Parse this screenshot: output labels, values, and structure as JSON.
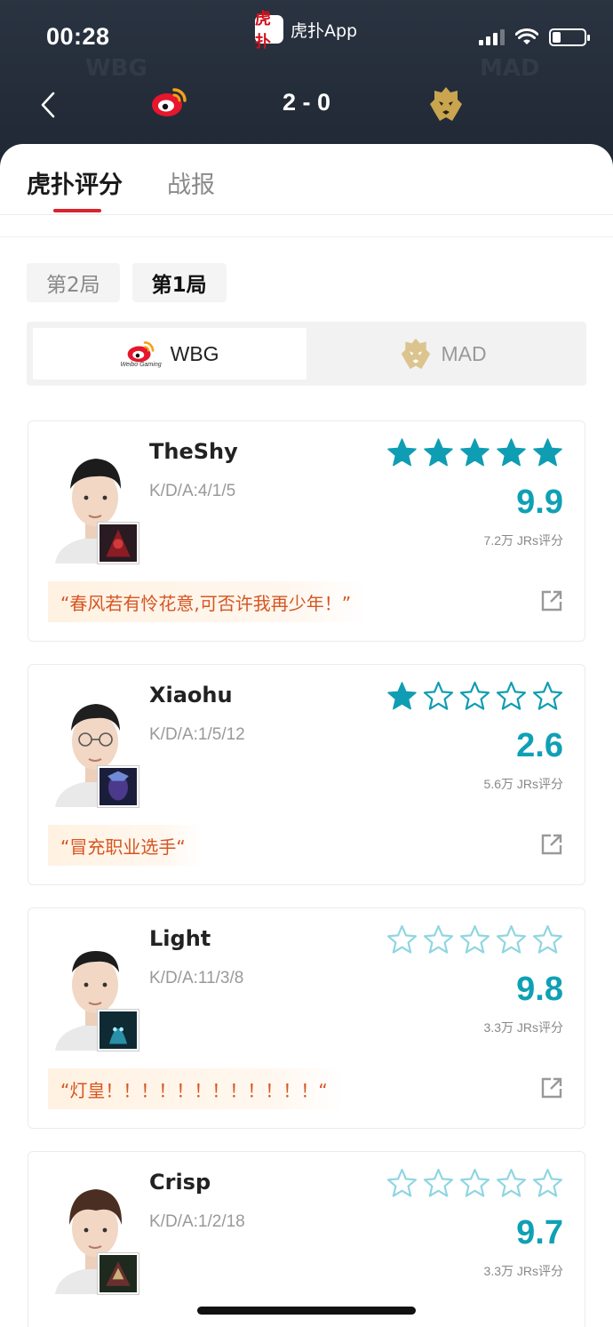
{
  "status_bar": {
    "time": "00:28",
    "app_name": "虎扑App",
    "app_logo_text": "虎扑"
  },
  "match": {
    "score": "2 - 0",
    "home_team_watermark": "WBG",
    "away_team_watermark": "MAD"
  },
  "tabs": [
    {
      "label": "虎扑评分",
      "active": true
    },
    {
      "label": "战报",
      "active": false
    }
  ],
  "rounds": [
    {
      "label": "第2局",
      "active": false
    },
    {
      "label": "第1局",
      "active": true
    }
  ],
  "teams": [
    {
      "name": "WBG",
      "logo_caption": "Weibo Gaming",
      "active": true
    },
    {
      "name": "MAD",
      "active": false
    }
  ],
  "players": [
    {
      "name": "TheShy",
      "kda": "K/D/A:4/1/5",
      "stars_filled": 5,
      "rating": "9.9",
      "votes": "7.2万 JRs评分",
      "comment": "“春风若有怜花意,可否许我再少年！”"
    },
    {
      "name": "Xiaohu",
      "kda": "K/D/A:1/5/12",
      "stars_filled": 1,
      "rating": "2.6",
      "votes": "5.6万 JRs评分",
      "comment": "“冒充职业选手“"
    },
    {
      "name": "Light",
      "kda": "K/D/A:11/3/8",
      "stars_filled": 0,
      "rating": "9.8",
      "votes": "3.3万 JRs评分",
      "comment": "“灯皇！！！！！！！！！！！！“"
    },
    {
      "name": "Crisp",
      "kda": "K/D/A:1/2/18",
      "stars_filled": 0,
      "rating": "9.7",
      "votes": "3.3万 JRs评分",
      "comment": ""
    }
  ],
  "colors": {
    "accent_red": "#d7232e",
    "rating_teal": "#0fa0b5",
    "star_filled": "#0f9db3",
    "star_outline": "#8fd6e1",
    "comment_text": "#d65521"
  }
}
